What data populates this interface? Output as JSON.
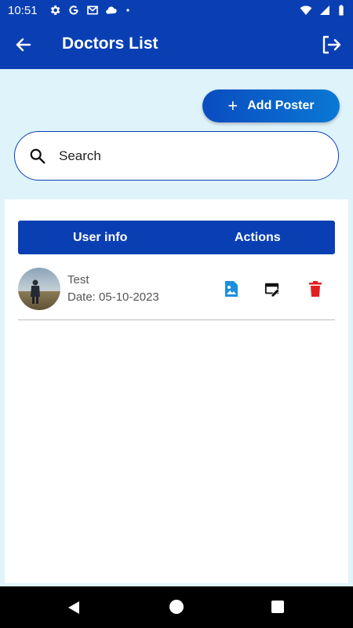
{
  "status_bar": {
    "time": "10:51",
    "left_icons": [
      "gear-icon",
      "google-icon",
      "gmail-icon",
      "cloud-icon",
      "dot-icon"
    ],
    "right_icons": [
      "wifi-icon",
      "signal-icon",
      "battery-icon"
    ]
  },
  "app_bar": {
    "title": "Doctors List",
    "color": "#0a3fb4"
  },
  "add_button": {
    "label": "Add Poster"
  },
  "search": {
    "placeholder": "Search",
    "value": ""
  },
  "table": {
    "headers": [
      "User info",
      "Actions"
    ],
    "rows": [
      {
        "name": "Test",
        "date": "Date: 05-10-2023"
      }
    ]
  },
  "colors": {
    "primary": "#0a3fb4",
    "background": "#dff3fb",
    "image_action": "#1a8fe0",
    "delete_action": "#e01f1f"
  }
}
